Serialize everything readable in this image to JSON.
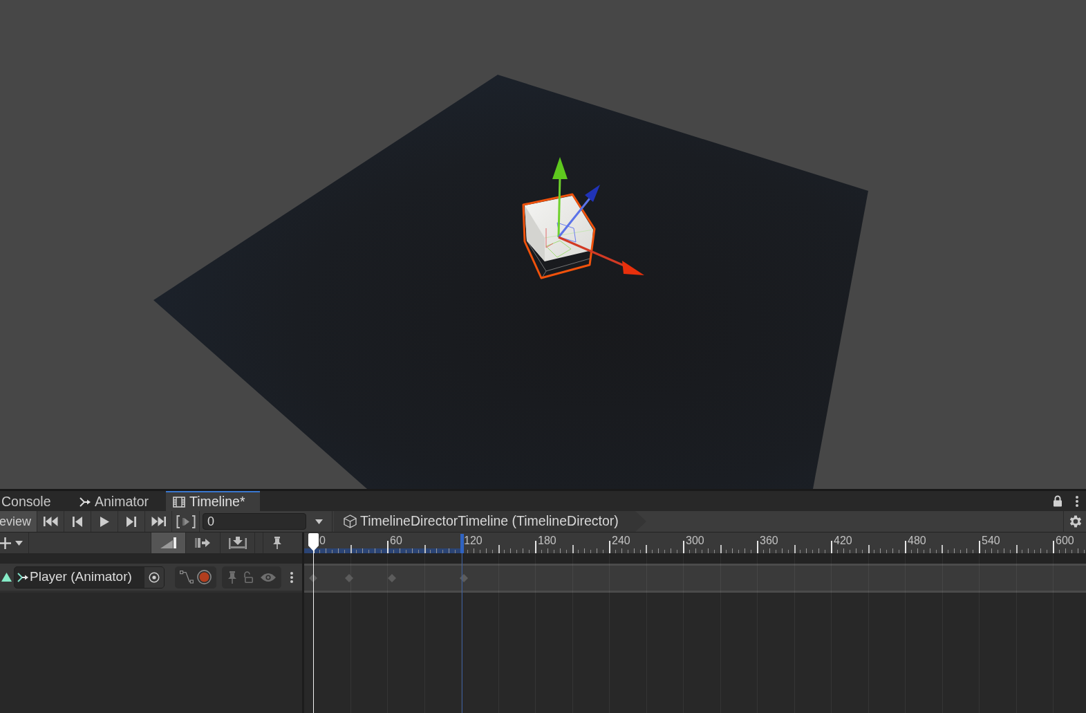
{
  "tabs": [
    {
      "label": "Console",
      "kind": "plain",
      "selected": false
    },
    {
      "label": "Animator",
      "kind": "animator",
      "selected": false
    },
    {
      "label": "Timeline*",
      "kind": "timeline",
      "selected": true
    }
  ],
  "toolbar": {
    "preview": {
      "label": "eview",
      "on": true
    },
    "frame_field": {
      "value": "0"
    },
    "breadcrumb": "TimelineDirectorTimeline (TimelineDirector)"
  },
  "edit_modes": [
    {
      "kind": "mix",
      "selected": true
    },
    {
      "kind": "ripple",
      "selected": false
    },
    {
      "kind": "replace",
      "selected": false
    }
  ],
  "ruler": {
    "labels": [
      "0",
      "60",
      "120",
      "180",
      "240",
      "300",
      "360",
      "420",
      "480",
      "540",
      "600"
    ],
    "playhead": {
      "level": 0.0115
    },
    "duration_end": {
      "level": 0.2016
    }
  },
  "tracks": [
    {
      "name": "Player (Animator)",
      "locked": false,
      "keyframes": [
        {
          "level": 0.0115
        },
        {
          "level": 0.0575
        },
        {
          "level": 0.1123
        },
        {
          "level": 0.2042
        }
      ]
    }
  ]
}
